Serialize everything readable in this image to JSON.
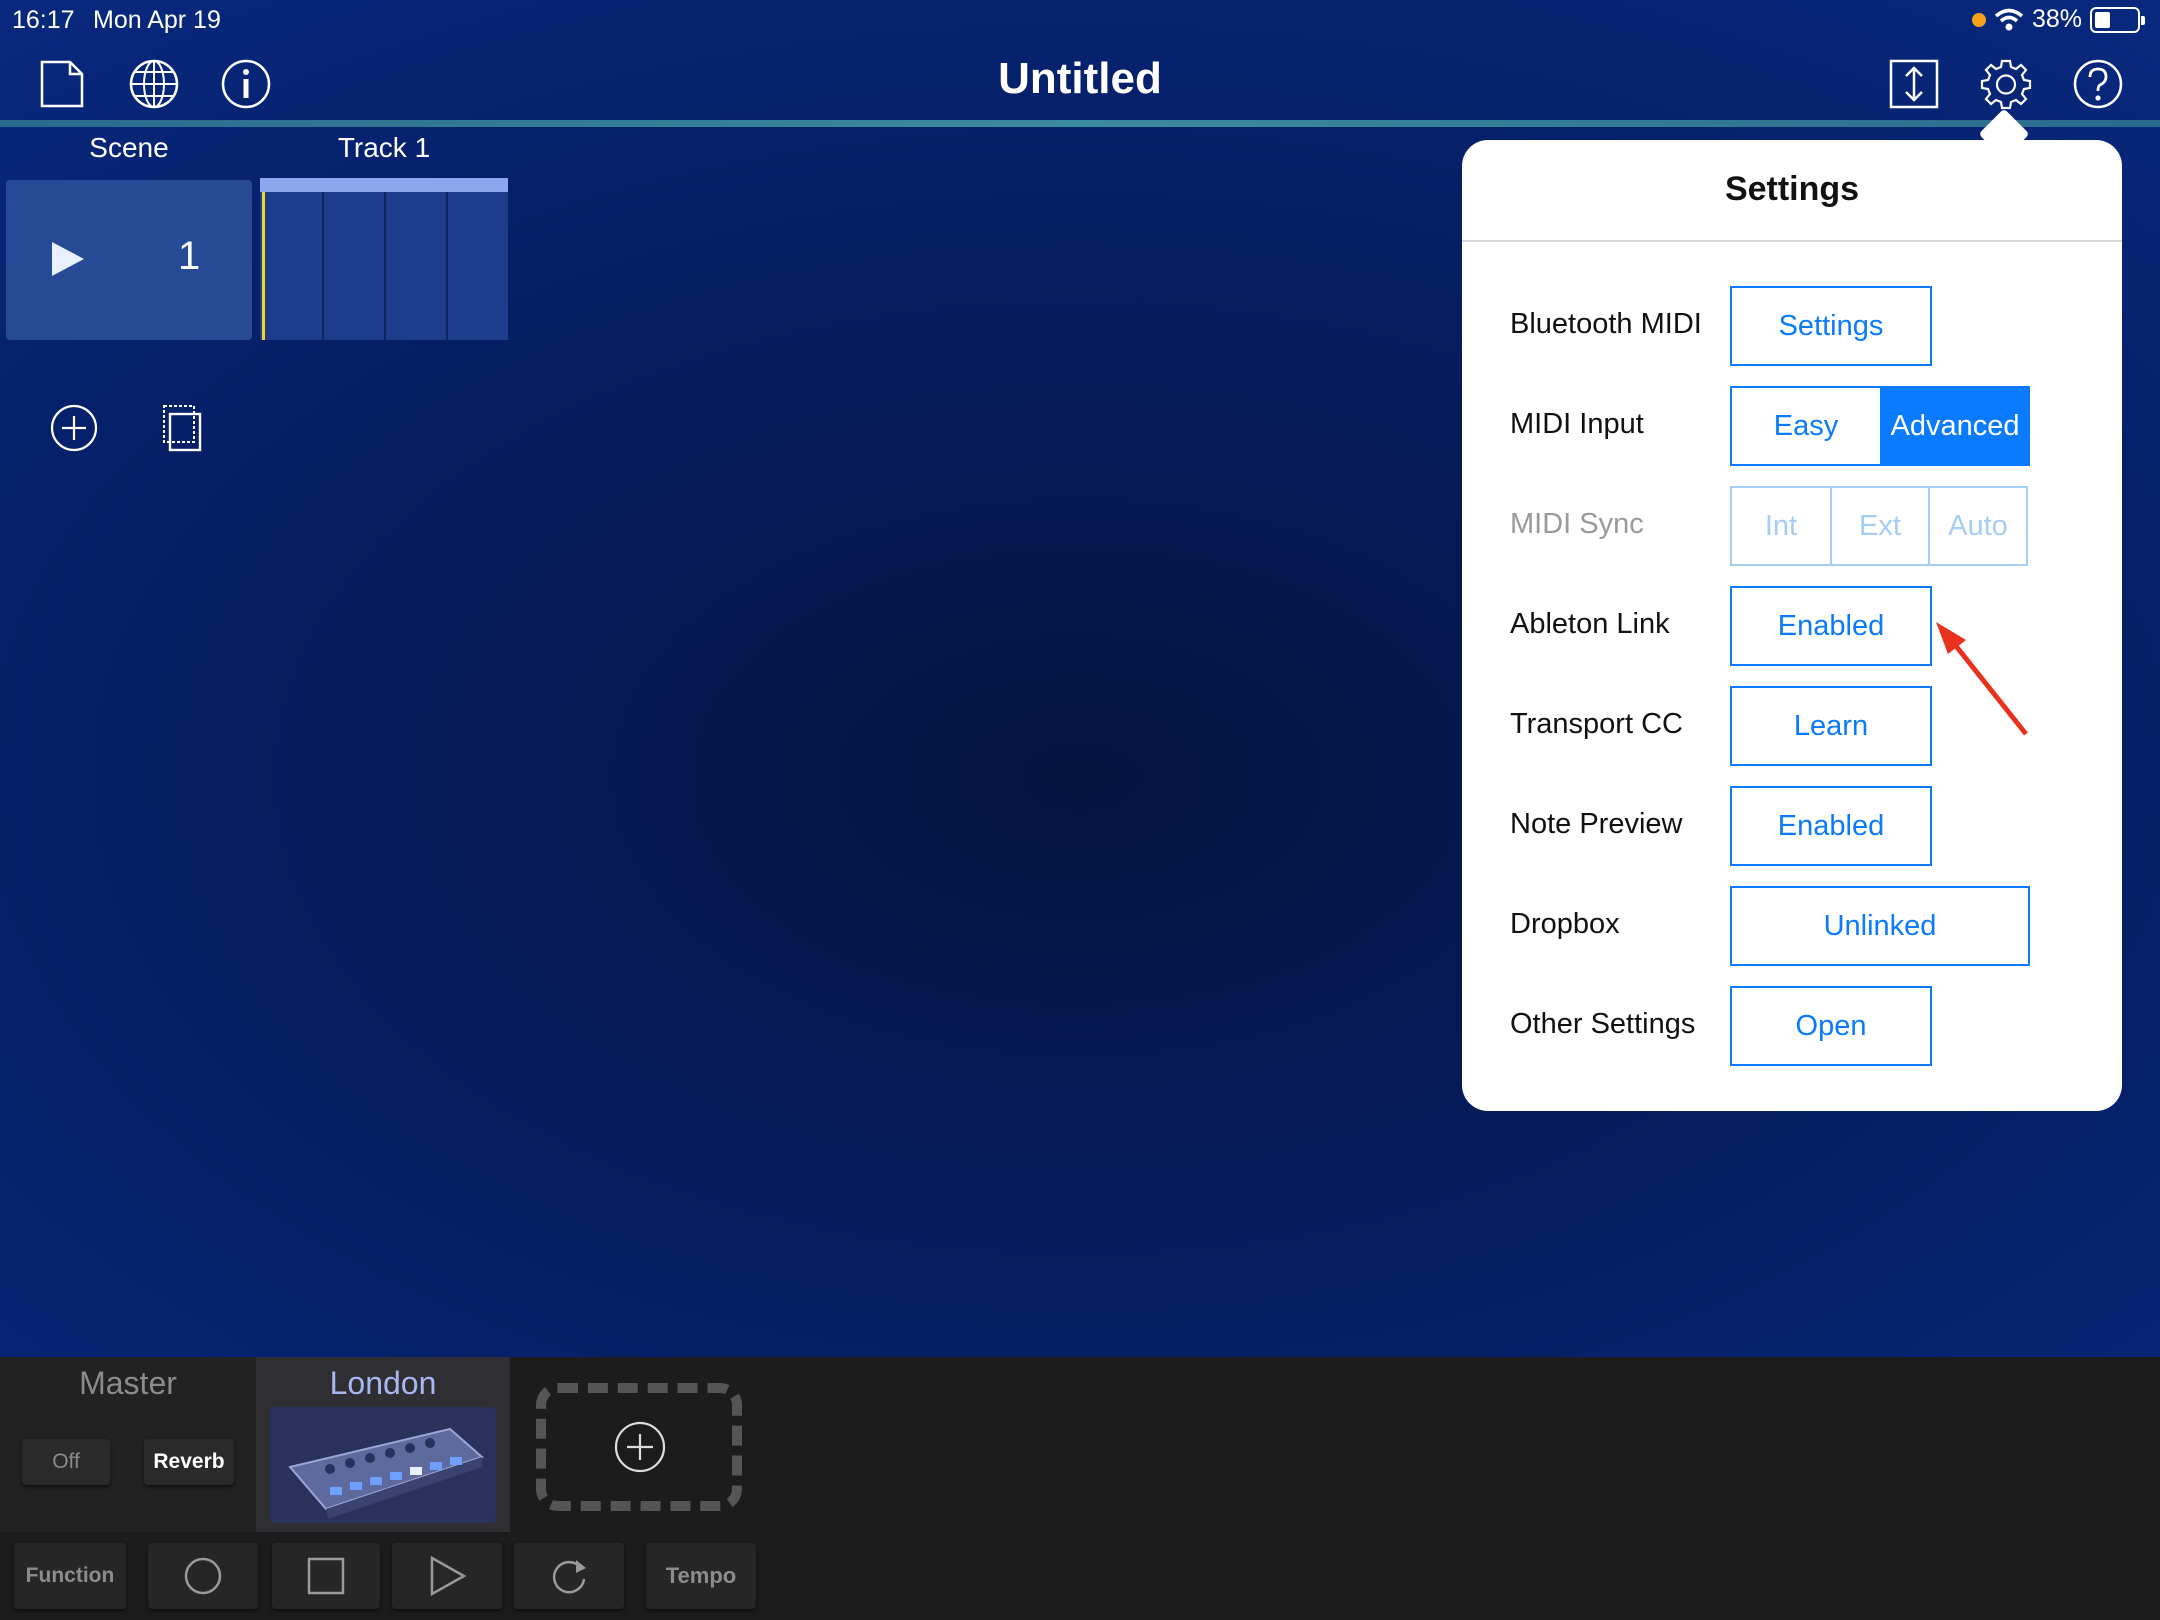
{
  "status_bar": {
    "time": "16:17",
    "date": "Mon Apr 19",
    "battery": "38%",
    "battery_level": 0.38
  },
  "toolbar": {
    "title": "Untitled",
    "left_icons": [
      "new-document-icon",
      "globe-icon",
      "info-icon"
    ],
    "right_icons": [
      "resize-icon",
      "gear-icon",
      "help-icon"
    ]
  },
  "grid": {
    "columns": [
      "Scene",
      "Track 1"
    ],
    "scene_number": "1"
  },
  "settings": {
    "title": "Settings",
    "rows": [
      {
        "label": "Bluetooth MIDI",
        "options": [
          "Settings"
        ],
        "selected": null,
        "disabled": false
      },
      {
        "label": "MIDI Input",
        "options": [
          "Easy",
          "Advanced"
        ],
        "selected": "Advanced",
        "disabled": false
      },
      {
        "label": "MIDI Sync",
        "options": [
          "Int",
          "Ext",
          "Auto"
        ],
        "selected": null,
        "disabled": true
      },
      {
        "label": "Ableton Link",
        "options": [
          "Enabled"
        ],
        "selected": null,
        "disabled": false
      },
      {
        "label": "Transport CC",
        "options": [
          "Learn"
        ],
        "selected": null,
        "disabled": false
      },
      {
        "label": "Note Preview",
        "options": [
          "Enabled"
        ],
        "selected": null,
        "disabled": false
      },
      {
        "label": "Dropbox",
        "options": [
          "Unlinked"
        ],
        "selected": null,
        "disabled": false
      },
      {
        "label": "Other Settings",
        "options": [
          "Open"
        ],
        "selected": null,
        "disabled": false
      }
    ]
  },
  "mixer": {
    "master": {
      "name": "Master",
      "off_label": "Off",
      "reverb_label": "Reverb"
    },
    "instrument": {
      "name": "London"
    }
  },
  "transport": {
    "function_label": "Function",
    "tempo_label": "Tempo",
    "icons": [
      "record-icon",
      "stop-icon",
      "play-icon",
      "loop-icon"
    ]
  },
  "colors": {
    "accent": "#0a7aff",
    "annotation": "#e8321e",
    "clip_cursor": "#f0d81e"
  }
}
